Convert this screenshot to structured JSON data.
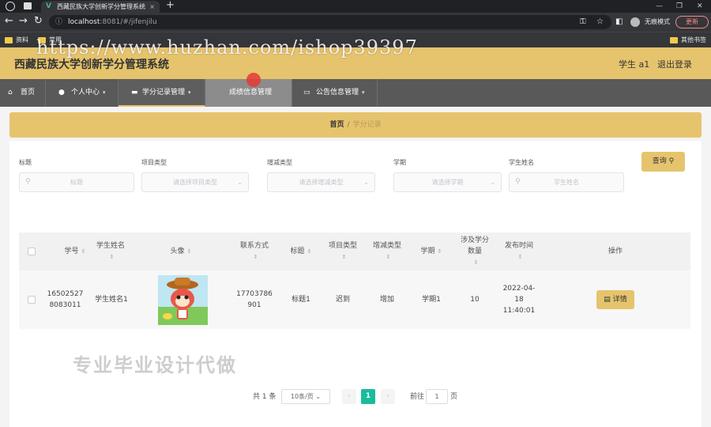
{
  "browser": {
    "tab_title": "西藏民族大学创新学分管理系统",
    "url_host": "localhost",
    "url_path": ":8081/#/jifenjilu",
    "guest_label": "无痕模式",
    "update_label": "更新",
    "bookmarks": [
      "资料",
      "常用"
    ],
    "other_bookmarks": "其他书签"
  },
  "watermark": "https://www.huzhan.com/ishop39397",
  "overlay": "专业毕业设计代做",
  "header": {
    "title": "西藏民族大学创新学分管理系统",
    "user": "学生 a1",
    "logout": "退出登录"
  },
  "menu": [
    {
      "label": "首页",
      "icon": "home-icon"
    },
    {
      "label": "个人中心",
      "icon": "user-icon"
    },
    {
      "label": "学分记录管理",
      "icon": "folder-icon"
    },
    {
      "label": "成绩信息管理",
      "icon": "grid-icon"
    },
    {
      "label": "公告信息管理",
      "icon": "message-icon"
    }
  ],
  "breadcrumb": {
    "home": "首页",
    "current": "学分记录"
  },
  "filters": {
    "title_label": "标题",
    "title_placeholder": "标题",
    "type_label": "项目类型",
    "type_placeholder": "请选择项目类型",
    "change_label": "增减类型",
    "change_placeholder": "请选择增减类型",
    "term_label": "学期",
    "term_placeholder": "请选择学期",
    "name_label": "学生姓名",
    "name_placeholder": "学生姓名",
    "query_button": "查询"
  },
  "table": {
    "headers": {
      "student_no": "学号",
      "student_name": "学生姓名",
      "avatar": "头像",
      "contact": "联系方式",
      "title": "标题",
      "project_type": "项目类型",
      "change_type": "增减类型",
      "term": "学期",
      "credits": "涉及学分数量",
      "publish_time": "发布时间",
      "actions": "操作"
    },
    "rows": [
      {
        "student_no": "16502527 8083011",
        "student_name": "学生姓名1",
        "contact": "17703786 901",
        "title": "标题1",
        "project_type": "迟到",
        "change_type": "增加",
        "term": "学期1",
        "credits": "10",
        "publish_time": "2022-04-18 11:40:01",
        "action": "详情"
      }
    ]
  },
  "pagination": {
    "total": "共 1 条",
    "page_size": "10条/页",
    "current_page": "1",
    "goto_label": "前往",
    "goto_value": "1",
    "page_unit": "页"
  },
  "colors": {
    "accent": "#e6c46d",
    "menubar": "#595959",
    "page_active": "#1abc9c"
  }
}
